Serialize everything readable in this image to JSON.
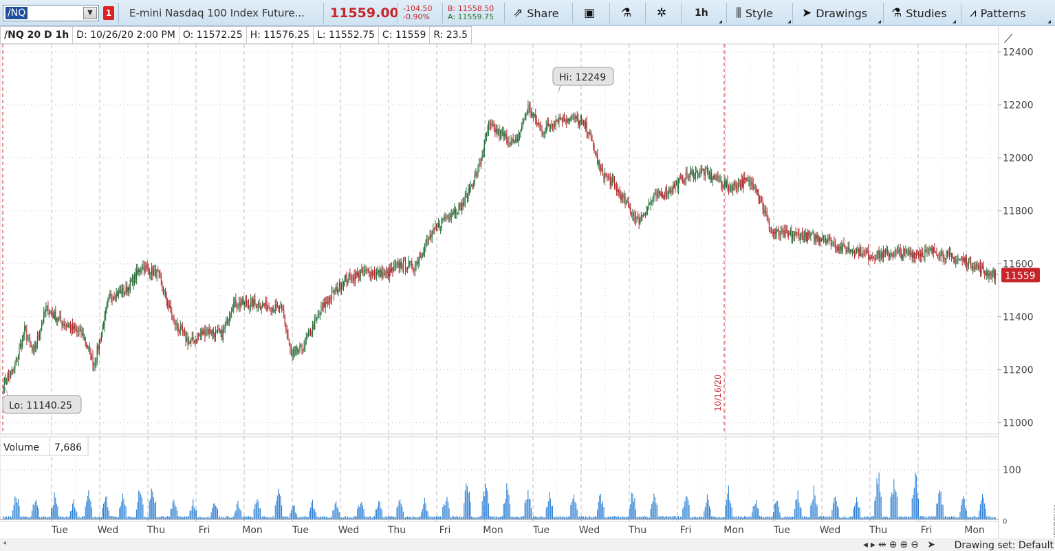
{
  "toolbar": {
    "symbol": "/NQ",
    "link_badge": "1",
    "description": "E-mini Nasdaq 100 Index Future...",
    "last_price": "11559.00",
    "change": "-104.50",
    "change_pct": "-0.90%",
    "bid": "B: 11558.50",
    "ask": "A: 11559.75",
    "share": "Share",
    "timeframe": "1h",
    "style": "Style",
    "drawings": "Drawings",
    "studies": "Studies",
    "patterns": "Patterns",
    "icons": {
      "share": "share-icon",
      "message": "message-center-icon",
      "flask": "flask-icon",
      "gear": "gear-icon",
      "style": "candlestick-style-icon",
      "drawings": "cursor-arrow-icon",
      "studies": "flask-icon",
      "patterns": "patterns-icon"
    }
  },
  "infobar": {
    "label": "/NQ 20 D 1h",
    "date": "D: 10/26/20 2:00 PM",
    "open": "O: 11572.25",
    "high": "H: 11576.25",
    "low": "L: 11552.75",
    "close": "C: 11559",
    "range": "R: 23.5"
  },
  "price_axis": {
    "ticks": [
      "12400",
      "12200",
      "12000",
      "11800",
      "11600",
      "11400",
      "11200",
      "11000"
    ],
    "current": "11559"
  },
  "annotations": {
    "hi": "Hi: 12249",
    "lo": "Lo: 11140.25",
    "date_marker": "10/16/20"
  },
  "volume": {
    "label": "Volume",
    "value": "7,686",
    "axis_ticks": [
      "100",
      "0"
    ],
    "unit": "<thousan..."
  },
  "x_axis": {
    "labels": [
      "Tue",
      "Wed",
      "Thu",
      "Fri",
      "Mon",
      "Tue",
      "Wed",
      "Thu",
      "Fri",
      "Mon",
      "Tue",
      "Wed",
      "Thu",
      "Fri",
      "Mon",
      "Tue",
      "Wed",
      "Thu",
      "Fri",
      "Mon"
    ]
  },
  "bottom": {
    "drawing_set": "Drawing set: Default"
  },
  "colors": {
    "up": "#1e6b35",
    "down": "#b3262b",
    "volume": "#2a7fd4",
    "accent_red": "#c8252b"
  },
  "chart_data": {
    "type": "candlestick",
    "title": "",
    "symbol": "/NQ",
    "period": "20 D",
    "interval": "1h",
    "ylim": [
      10960,
      12430
    ],
    "hi": 12249,
    "lo": 11140.25,
    "last": 11559,
    "anchors": [
      [
        0,
        11150
      ],
      [
        10,
        11200
      ],
      [
        20,
        11350
      ],
      [
        28,
        11260
      ],
      [
        40,
        11430
      ],
      [
        55,
        11380
      ],
      [
        75,
        11330
      ],
      [
        85,
        11220
      ],
      [
        100,
        11480
      ],
      [
        115,
        11500
      ],
      [
        130,
        11590
      ],
      [
        145,
        11560
      ],
      [
        160,
        11380
      ],
      [
        175,
        11300
      ],
      [
        190,
        11350
      ],
      [
        205,
        11330
      ],
      [
        215,
        11450
      ],
      [
        235,
        11450
      ],
      [
        250,
        11440
      ],
      [
        262,
        11420
      ],
      [
        270,
        11250
      ],
      [
        280,
        11280
      ],
      [
        300,
        11440
      ],
      [
        320,
        11540
      ],
      [
        340,
        11570
      ],
      [
        360,
        11560
      ],
      [
        372,
        11600
      ],
      [
        385,
        11590
      ],
      [
        400,
        11700
      ],
      [
        415,
        11780
      ],
      [
        430,
        11820
      ],
      [
        445,
        11950
      ],
      [
        455,
        12120
      ],
      [
        470,
        12080
      ],
      [
        480,
        12050
      ],
      [
        492,
        12190
      ],
      [
        505,
        12100
      ],
      [
        520,
        12150
      ],
      [
        535,
        12150
      ],
      [
        548,
        12110
      ],
      [
        560,
        11950
      ],
      [
        572,
        11900
      ],
      [
        585,
        11820
      ],
      [
        595,
        11760
      ],
      [
        610,
        11850
      ],
      [
        625,
        11880
      ],
      [
        640,
        11930
      ],
      [
        655,
        11950
      ],
      [
        668,
        11920
      ],
      [
        680,
        11890
      ],
      [
        695,
        11910
      ],
      [
        705,
        11900
      ],
      [
        720,
        11720
      ],
      [
        730,
        11710
      ],
      [
        745,
        11710
      ],
      [
        755,
        11700
      ],
      [
        770,
        11700
      ],
      [
        785,
        11660
      ],
      [
        800,
        11650
      ],
      [
        815,
        11630
      ],
      [
        830,
        11640
      ],
      [
        845,
        11640
      ],
      [
        860,
        11640
      ],
      [
        875,
        11650
      ],
      [
        890,
        11620
      ],
      [
        905,
        11610
      ],
      [
        920,
        11570
      ],
      [
        930,
        11559
      ]
    ],
    "volume_peaks": [
      [
        12,
        65
      ],
      [
        30,
        55
      ],
      [
        48,
        58
      ],
      [
        66,
        45
      ],
      [
        80,
        60
      ],
      [
        96,
        62
      ],
      [
        112,
        68
      ],
      [
        128,
        72
      ],
      [
        140,
        85
      ],
      [
        160,
        48
      ],
      [
        178,
        45
      ],
      [
        198,
        50
      ],
      [
        220,
        38
      ],
      [
        238,
        52
      ],
      [
        258,
        75
      ],
      [
        272,
        36
      ],
      [
        290,
        42
      ],
      [
        312,
        46
      ],
      [
        335,
        48
      ],
      [
        352,
        44
      ],
      [
        372,
        52
      ],
      [
        395,
        45
      ],
      [
        415,
        58
      ],
      [
        435,
        96
      ],
      [
        452,
        90
      ],
      [
        472,
        84
      ],
      [
        492,
        75
      ],
      [
        512,
        62
      ],
      [
        535,
        68
      ],
      [
        560,
        60
      ],
      [
        590,
        68
      ],
      [
        610,
        70
      ],
      [
        640,
        65
      ],
      [
        660,
        55
      ],
      [
        680,
        70
      ],
      [
        705,
        50
      ],
      [
        725,
        48
      ],
      [
        745,
        62
      ],
      [
        760,
        70
      ],
      [
        780,
        60
      ],
      [
        800,
        56
      ],
      [
        820,
        118
      ],
      [
        835,
        100
      ],
      [
        855,
        108
      ],
      [
        878,
        72
      ],
      [
        900,
        55
      ],
      [
        918,
        58
      ]
    ]
  }
}
